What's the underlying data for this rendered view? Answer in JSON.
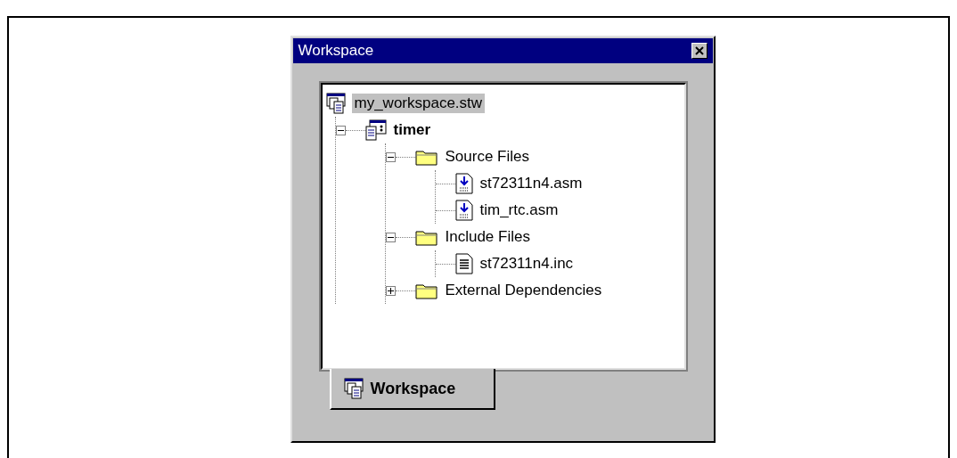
{
  "window": {
    "title": "Workspace"
  },
  "tree": [
    {
      "kind": "workspace",
      "label": "my_workspace.stw",
      "selected": true,
      "active": false,
      "children": [
        {
          "kind": "project",
          "label": "timer",
          "selected": false,
          "active": true,
          "expanded": true,
          "children": [
            {
              "kind": "folder",
              "label": "Source Files",
              "selected": false,
              "active": false,
              "expanded": true,
              "children": [
                {
                  "kind": "asm",
                  "label": "st72311n4.asm",
                  "selected": false,
                  "active": false
                },
                {
                  "kind": "asm",
                  "label": "tim_rtc.asm",
                  "selected": false,
                  "active": false
                }
              ]
            },
            {
              "kind": "folder",
              "label": "Include Files",
              "selected": false,
              "active": false,
              "expanded": true,
              "children": [
                {
                  "kind": "inc",
                  "label": "st72311n4.inc",
                  "selected": false,
                  "active": false
                }
              ]
            },
            {
              "kind": "folder",
              "label": "External Dependencies",
              "selected": false,
              "active": false,
              "expanded": false
            }
          ]
        }
      ]
    }
  ],
  "tabs": [
    {
      "label": "Workspace",
      "selected": true
    }
  ]
}
